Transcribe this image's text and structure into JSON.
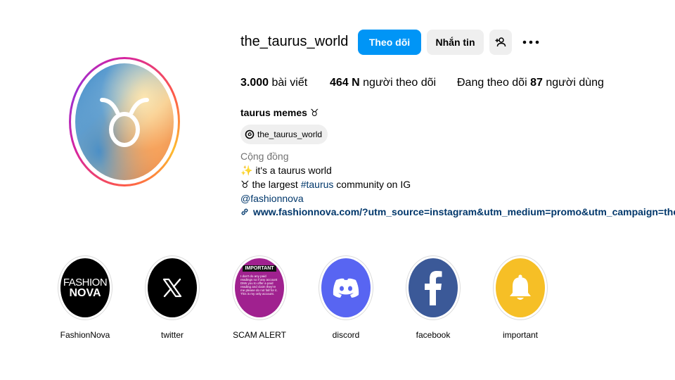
{
  "profile": {
    "username": "the_taurus_world",
    "follow_label": "Theo dõi",
    "message_label": "Nhắn tin",
    "posts_count": "3.000",
    "posts_label": "bài viết",
    "followers_count": "464 N",
    "followers_label": "người theo dõi",
    "following_prefix": "Đang theo dõi",
    "following_count": "87",
    "following_suffix": "người dùng",
    "full_name": "taurus memes ♉",
    "threads_handle": "the_taurus_world",
    "category": "Cộng đồng",
    "bio_line1": "✨ it's a taurus world",
    "bio_line2_prefix": "♉ the largest",
    "bio_line2_hashtag": "#taurus",
    "bio_line2_suffix": "community on IG",
    "bio_mention": "@fashionnova",
    "link": "www.fashionnova.com/?utm_source=instagram&utm_medium=promo&utm_campaign=the_taurus_world"
  },
  "highlights": [
    {
      "label": "FashionNova",
      "logo_top": "FASHION",
      "logo_bottom": "NOVA"
    },
    {
      "label": "twitter"
    },
    {
      "label": "SCAM ALERT",
      "head": "IMPORTANT",
      "text": "I don't do any paid readings so if any account DMs you to offer a paid reading and claim they're me please do not fall for it. This is my only account."
    },
    {
      "label": "discord"
    },
    {
      "label": "facebook"
    },
    {
      "label": "important"
    }
  ],
  "colors": {
    "accent": "#0095f6",
    "link": "#00376b",
    "button_bg": "#efefef",
    "muted": "#737373"
  }
}
